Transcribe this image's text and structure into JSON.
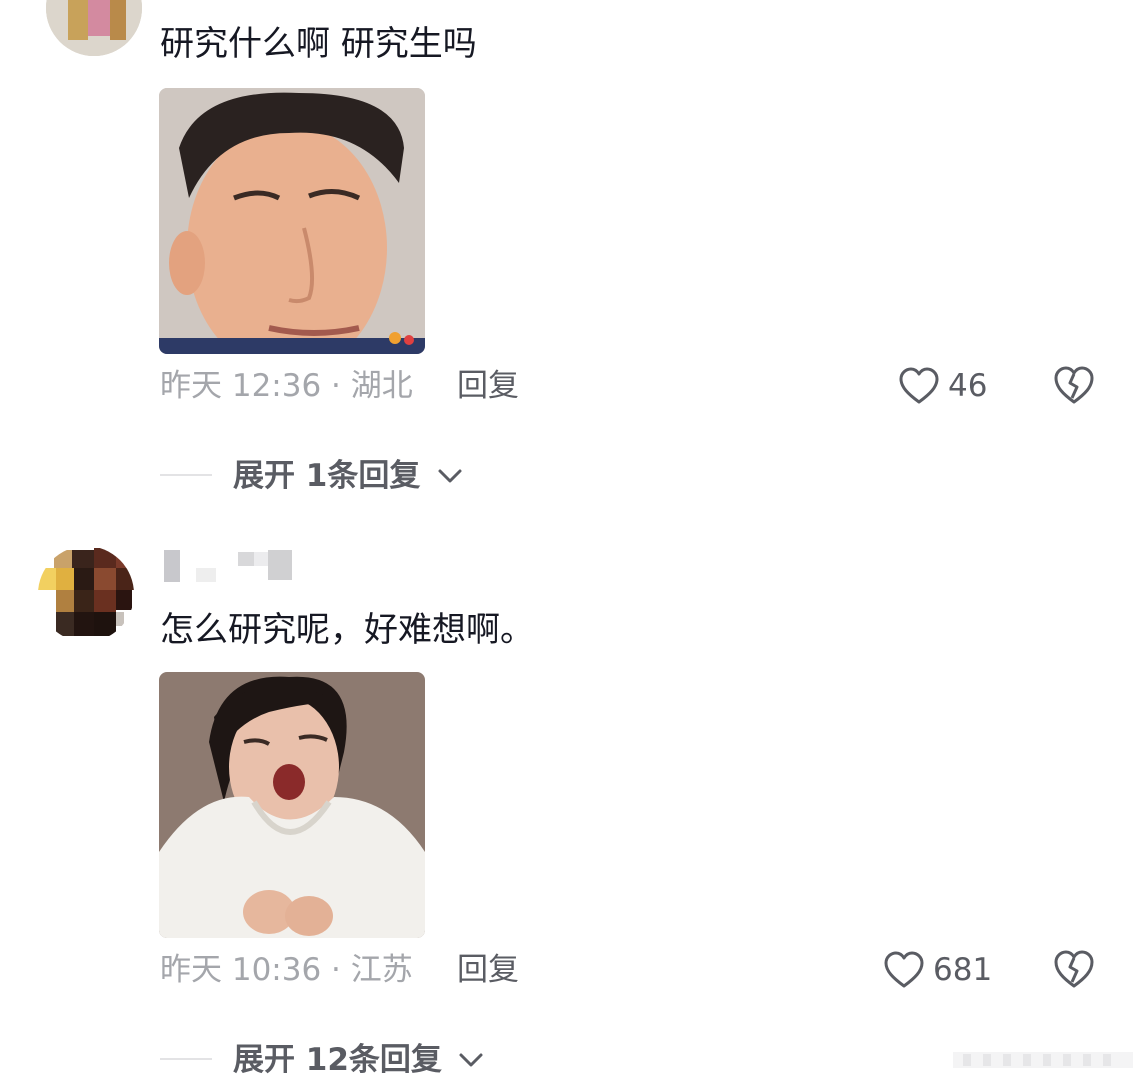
{
  "comments": [
    {
      "text": "研究什么啊 研究生吗",
      "meta": "昨天 12:36 · 湖北",
      "reply_label": "回复",
      "likes": "46",
      "expand_label": "展开 1条回复"
    },
    {
      "text": "怎么研究呢，好难想啊。",
      "meta": "昨天 10:36 · 江苏",
      "reply_label": "回复",
      "likes": "681",
      "expand_label": "展开 12条回复"
    }
  ],
  "icons": {
    "like": "heart-outline-icon",
    "dislike": "broken-heart-icon",
    "expand": "chevron-down-icon"
  },
  "colors": {
    "text_primary": "#161823",
    "text_meta": "#a4a6ab",
    "text_secondary": "#5a5c63"
  }
}
